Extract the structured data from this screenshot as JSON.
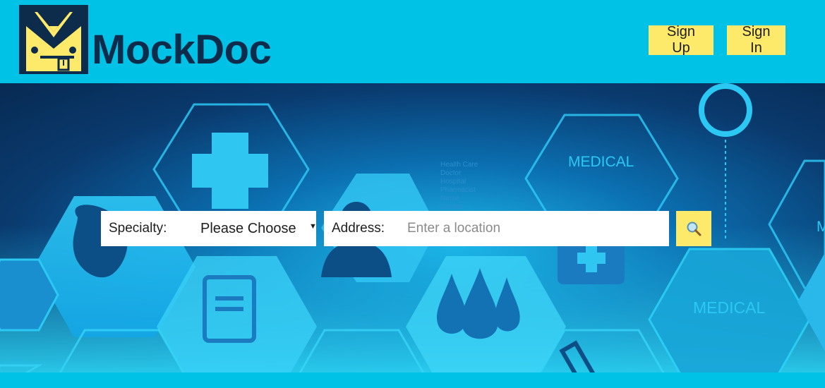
{
  "brand": {
    "name": "MockDoc",
    "colors": {
      "header_bg": "#00c1e6",
      "button_bg": "#fde96a",
      "logo_text": "#0d2b4a"
    }
  },
  "header": {
    "signup_label": "Sign Up",
    "signin_label": "Sign In"
  },
  "hero": {
    "background_icons": [
      "medical-cross-icon",
      "heart-icon",
      "clipboard-icon",
      "doctor-icon",
      "blood-drops-icon",
      "medical-bag-icon",
      "test-tube-icon",
      "stethoscope-icon"
    ],
    "overlay_texts": [
      "MEDICAL",
      "MEDICAL",
      "Health Care",
      "Doctor",
      "Hospital",
      "Pharmacist",
      "Nurse",
      "Dentist",
      "M"
    ]
  },
  "search": {
    "specialty_label": "Specialty:",
    "specialty_value": "Please Choose",
    "address_label": "Address:",
    "address_placeholder": "Enter a location",
    "search_icon": "magnifier-icon"
  }
}
